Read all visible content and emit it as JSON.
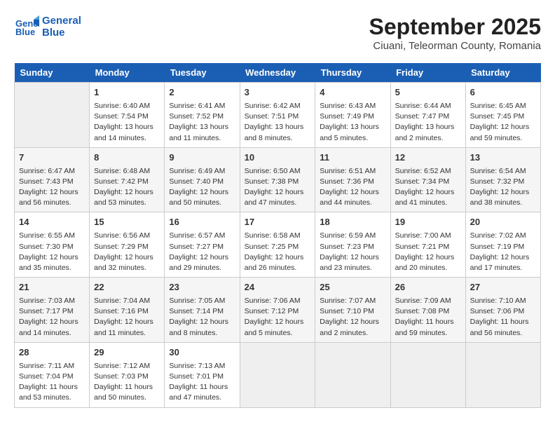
{
  "header": {
    "logo_line1": "General",
    "logo_line2": "Blue",
    "month": "September 2025",
    "location": "Ciuani, Teleorman County, Romania"
  },
  "days_of_week": [
    "Sunday",
    "Monday",
    "Tuesday",
    "Wednesday",
    "Thursday",
    "Friday",
    "Saturday"
  ],
  "weeks": [
    [
      {
        "day": "",
        "empty": true
      },
      {
        "day": "1",
        "sunrise": "Sunrise: 6:40 AM",
        "sunset": "Sunset: 7:54 PM",
        "daylight": "Daylight: 13 hours and 14 minutes."
      },
      {
        "day": "2",
        "sunrise": "Sunrise: 6:41 AM",
        "sunset": "Sunset: 7:52 PM",
        "daylight": "Daylight: 13 hours and 11 minutes."
      },
      {
        "day": "3",
        "sunrise": "Sunrise: 6:42 AM",
        "sunset": "Sunset: 7:51 PM",
        "daylight": "Daylight: 13 hours and 8 minutes."
      },
      {
        "day": "4",
        "sunrise": "Sunrise: 6:43 AM",
        "sunset": "Sunset: 7:49 PM",
        "daylight": "Daylight: 13 hours and 5 minutes."
      },
      {
        "day": "5",
        "sunrise": "Sunrise: 6:44 AM",
        "sunset": "Sunset: 7:47 PM",
        "daylight": "Daylight: 13 hours and 2 minutes."
      },
      {
        "day": "6",
        "sunrise": "Sunrise: 6:45 AM",
        "sunset": "Sunset: 7:45 PM",
        "daylight": "Daylight: 12 hours and 59 minutes."
      }
    ],
    [
      {
        "day": "7",
        "sunrise": "Sunrise: 6:47 AM",
        "sunset": "Sunset: 7:43 PM",
        "daylight": "Daylight: 12 hours and 56 minutes."
      },
      {
        "day": "8",
        "sunrise": "Sunrise: 6:48 AM",
        "sunset": "Sunset: 7:42 PM",
        "daylight": "Daylight: 12 hours and 53 minutes."
      },
      {
        "day": "9",
        "sunrise": "Sunrise: 6:49 AM",
        "sunset": "Sunset: 7:40 PM",
        "daylight": "Daylight: 12 hours and 50 minutes."
      },
      {
        "day": "10",
        "sunrise": "Sunrise: 6:50 AM",
        "sunset": "Sunset: 7:38 PM",
        "daylight": "Daylight: 12 hours and 47 minutes."
      },
      {
        "day": "11",
        "sunrise": "Sunrise: 6:51 AM",
        "sunset": "Sunset: 7:36 PM",
        "daylight": "Daylight: 12 hours and 44 minutes."
      },
      {
        "day": "12",
        "sunrise": "Sunrise: 6:52 AM",
        "sunset": "Sunset: 7:34 PM",
        "daylight": "Daylight: 12 hours and 41 minutes."
      },
      {
        "day": "13",
        "sunrise": "Sunrise: 6:54 AM",
        "sunset": "Sunset: 7:32 PM",
        "daylight": "Daylight: 12 hours and 38 minutes."
      }
    ],
    [
      {
        "day": "14",
        "sunrise": "Sunrise: 6:55 AM",
        "sunset": "Sunset: 7:30 PM",
        "daylight": "Daylight: 12 hours and 35 minutes."
      },
      {
        "day": "15",
        "sunrise": "Sunrise: 6:56 AM",
        "sunset": "Sunset: 7:29 PM",
        "daylight": "Daylight: 12 hours and 32 minutes."
      },
      {
        "day": "16",
        "sunrise": "Sunrise: 6:57 AM",
        "sunset": "Sunset: 7:27 PM",
        "daylight": "Daylight: 12 hours and 29 minutes."
      },
      {
        "day": "17",
        "sunrise": "Sunrise: 6:58 AM",
        "sunset": "Sunset: 7:25 PM",
        "daylight": "Daylight: 12 hours and 26 minutes."
      },
      {
        "day": "18",
        "sunrise": "Sunrise: 6:59 AM",
        "sunset": "Sunset: 7:23 PM",
        "daylight": "Daylight: 12 hours and 23 minutes."
      },
      {
        "day": "19",
        "sunrise": "Sunrise: 7:00 AM",
        "sunset": "Sunset: 7:21 PM",
        "daylight": "Daylight: 12 hours and 20 minutes."
      },
      {
        "day": "20",
        "sunrise": "Sunrise: 7:02 AM",
        "sunset": "Sunset: 7:19 PM",
        "daylight": "Daylight: 12 hours and 17 minutes."
      }
    ],
    [
      {
        "day": "21",
        "sunrise": "Sunrise: 7:03 AM",
        "sunset": "Sunset: 7:17 PM",
        "daylight": "Daylight: 12 hours and 14 minutes."
      },
      {
        "day": "22",
        "sunrise": "Sunrise: 7:04 AM",
        "sunset": "Sunset: 7:16 PM",
        "daylight": "Daylight: 12 hours and 11 minutes."
      },
      {
        "day": "23",
        "sunrise": "Sunrise: 7:05 AM",
        "sunset": "Sunset: 7:14 PM",
        "daylight": "Daylight: 12 hours and 8 minutes."
      },
      {
        "day": "24",
        "sunrise": "Sunrise: 7:06 AM",
        "sunset": "Sunset: 7:12 PM",
        "daylight": "Daylight: 12 hours and 5 minutes."
      },
      {
        "day": "25",
        "sunrise": "Sunrise: 7:07 AM",
        "sunset": "Sunset: 7:10 PM",
        "daylight": "Daylight: 12 hours and 2 minutes."
      },
      {
        "day": "26",
        "sunrise": "Sunrise: 7:09 AM",
        "sunset": "Sunset: 7:08 PM",
        "daylight": "Daylight: 11 hours and 59 minutes."
      },
      {
        "day": "27",
        "sunrise": "Sunrise: 7:10 AM",
        "sunset": "Sunset: 7:06 PM",
        "daylight": "Daylight: 11 hours and 56 minutes."
      }
    ],
    [
      {
        "day": "28",
        "sunrise": "Sunrise: 7:11 AM",
        "sunset": "Sunset: 7:04 PM",
        "daylight": "Daylight: 11 hours and 53 minutes."
      },
      {
        "day": "29",
        "sunrise": "Sunrise: 7:12 AM",
        "sunset": "Sunset: 7:03 PM",
        "daylight": "Daylight: 11 hours and 50 minutes."
      },
      {
        "day": "30",
        "sunrise": "Sunrise: 7:13 AM",
        "sunset": "Sunset: 7:01 PM",
        "daylight": "Daylight: 11 hours and 47 minutes."
      },
      {
        "day": "",
        "empty": true
      },
      {
        "day": "",
        "empty": true
      },
      {
        "day": "",
        "empty": true
      },
      {
        "day": "",
        "empty": true
      }
    ]
  ]
}
